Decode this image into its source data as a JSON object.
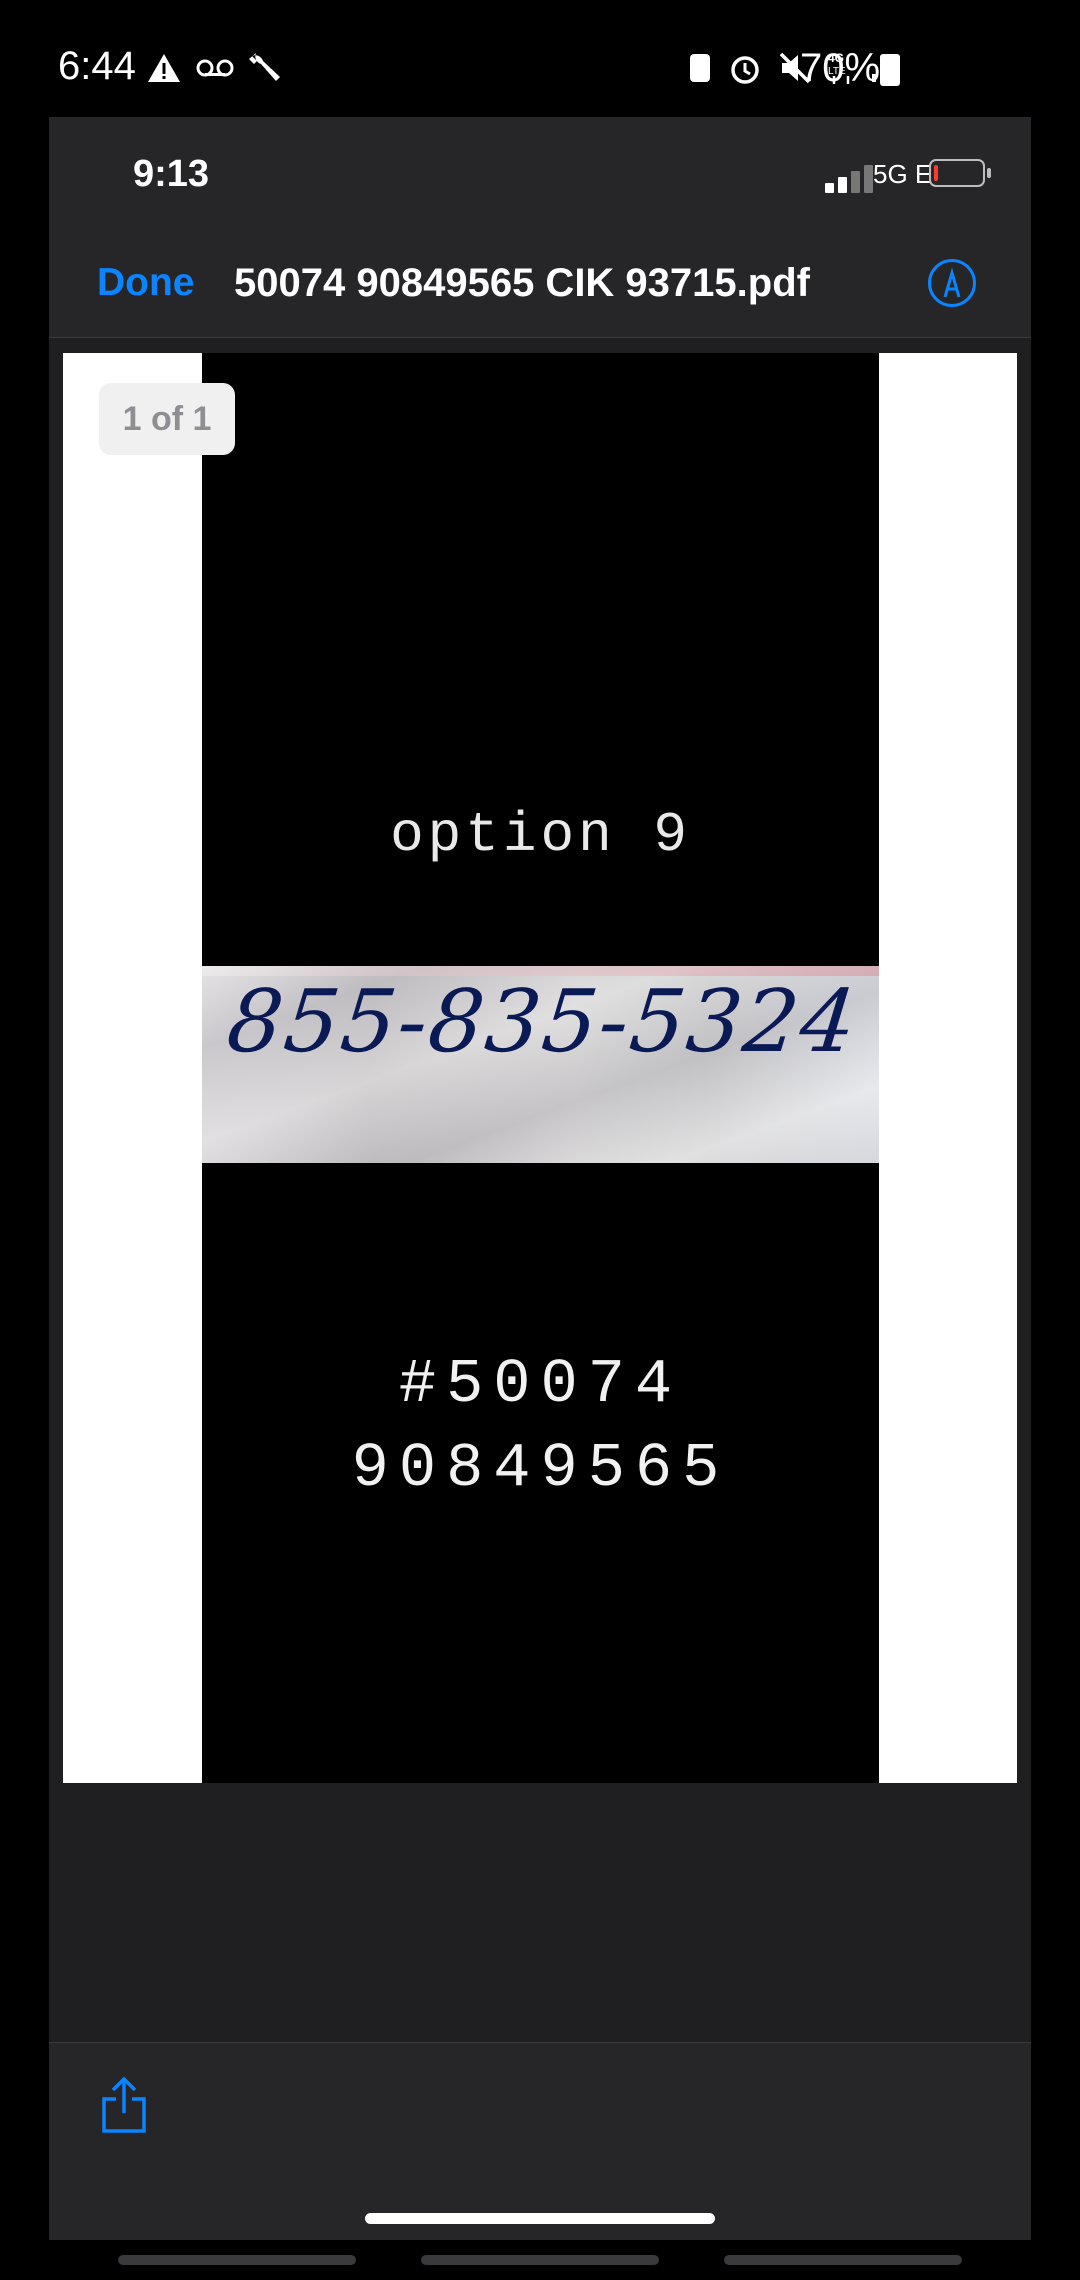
{
  "android_status": {
    "time": "6:44",
    "battery": "70%",
    "left_icons": [
      "warning-icon",
      "voicemail-icon",
      "wrench-icon"
    ],
    "right_icons": [
      "sim-icon",
      "alarm-icon",
      "mute-icon",
      "4g-lte-icon",
      "signal-icon"
    ]
  },
  "ios_status": {
    "time": "9:13",
    "network": "5G E"
  },
  "viewer": {
    "done_label": "Done",
    "file_title": "50074 90849565 CIK 93715.pdf",
    "page_counter": "1 of 1"
  },
  "document": {
    "option_text": "option 9",
    "handwritten_number": "855-835-5324",
    "account_line1": "#50074",
    "account_line2": "90849565"
  },
  "colors": {
    "accent": "#0a84ff",
    "header_bg": "#262628",
    "body_bg": "#1f1f21"
  }
}
